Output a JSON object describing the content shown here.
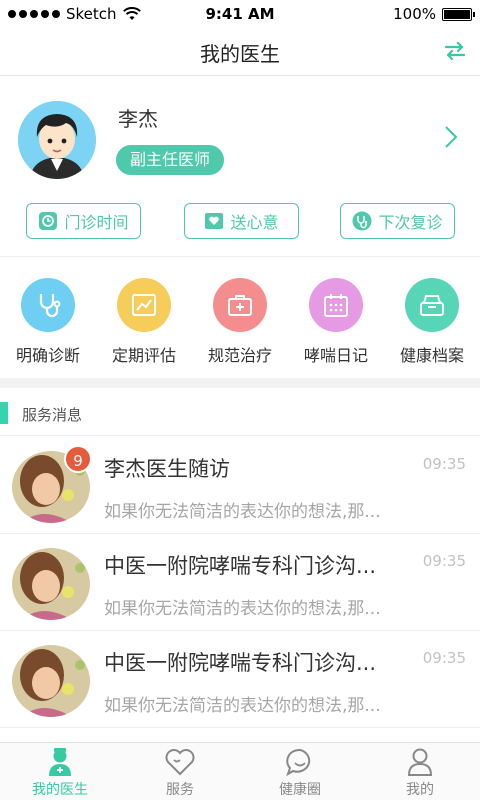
{
  "status_bar": {
    "carrier": "Sketch",
    "time": "9:41 AM",
    "battery": "100%"
  },
  "nav": {
    "title": "我的医生",
    "switch_icon": "switch-icon"
  },
  "doctor": {
    "name": "李杰",
    "title": "副主任医师",
    "actions": [
      {
        "label": "门诊时间",
        "icon": "clinic-time-icon"
      },
      {
        "label": "送心意",
        "icon": "gift-heart-icon"
      },
      {
        "label": "下次复诊",
        "icon": "stethoscope-icon"
      }
    ]
  },
  "grid": [
    {
      "label": "明确诊断",
      "icon": "stethoscope-icon",
      "color": "#6ecff2"
    },
    {
      "label": "定期评估",
      "icon": "chart-icon",
      "color": "#f6cd5b"
    },
    {
      "label": "规范治疗",
      "icon": "medkit-icon",
      "color": "#f48e8e"
    },
    {
      "label": "哮喘日记",
      "icon": "calendar-icon",
      "color": "#e59ae3"
    },
    {
      "label": "健康档案",
      "icon": "archive-icon",
      "color": "#56d6b6"
    }
  ],
  "section": {
    "title": "服务消息"
  },
  "messages": [
    {
      "title": "李杰医生随访",
      "time": "09:35",
      "preview": "如果你无法简洁的表达你的想法,那...",
      "badge": "9"
    },
    {
      "title": "中医一附院哮喘专科门诊沟...",
      "time": "09:35",
      "preview": "如果你无法简洁的表达你的想法,那...",
      "badge": ""
    },
    {
      "title": "中医一附院哮喘专科门诊沟...",
      "time": "09:35",
      "preview": "如果你无法简洁的表达你的想法,那...",
      "badge": ""
    }
  ],
  "tabs": [
    {
      "label": "我的医生",
      "icon": "doctor-icon"
    },
    {
      "label": "服务",
      "icon": "heart-icon"
    },
    {
      "label": "健康圈",
      "icon": "chat-icon"
    },
    {
      "label": "我的",
      "icon": "user-icon"
    }
  ],
  "colors": {
    "accent": "#4fc8ab",
    "badge": "#e55b3b"
  }
}
